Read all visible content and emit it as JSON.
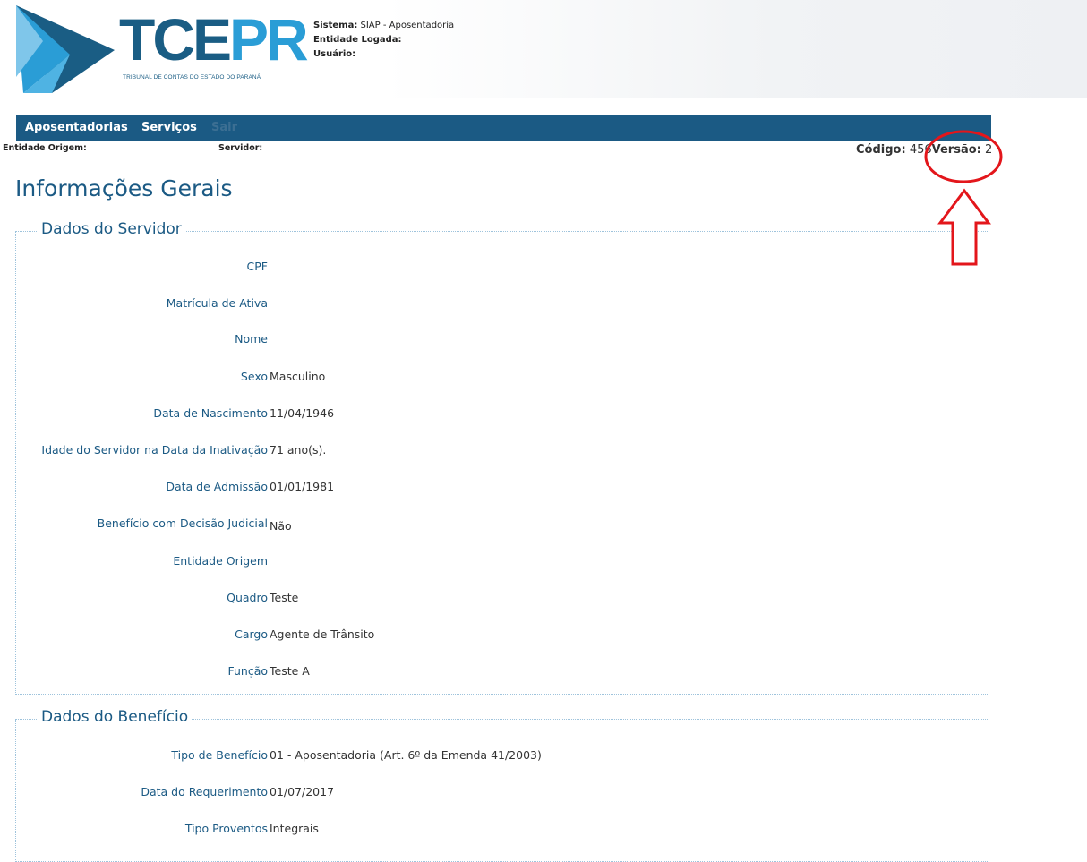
{
  "header": {
    "logo_tce": "TCE",
    "logo_pr": "PR",
    "logo_subtitle": "TRIBUNAL DE CONTAS DO ESTADO DO PARANÁ",
    "sistema_label": "Sistema:",
    "sistema_value": "SIAP - Aposentadoria",
    "entidade_label": "Entidade Logada:",
    "usuario_label": "Usuário:"
  },
  "menu": {
    "items": [
      "Aposentadorias",
      "Serviços",
      "Sair"
    ]
  },
  "subbar": {
    "entidade_origem_label": "Entidade Origem:",
    "servidor_label": "Servidor:",
    "codigo_label": "Código:",
    "codigo_value": "456",
    "versao_label": "Versão:",
    "versao_value": "2"
  },
  "page": {
    "title": "Informações Gerais"
  },
  "dados_servidor": {
    "legend": "Dados do Servidor",
    "rows": [
      {
        "label": "CPF",
        "value": ""
      },
      {
        "label": "Matrícula de Ativa",
        "value": ""
      },
      {
        "label": "Nome",
        "value": ""
      },
      {
        "label": "Sexo",
        "value": "Masculino"
      },
      {
        "label": "Data de Nascimento",
        "value": "11/04/1946"
      },
      {
        "label": "Idade do Servidor na Data da Inativação",
        "value": "71 ano(s)."
      },
      {
        "label": "Data de Admissão",
        "value": "01/01/1981"
      },
      {
        "label": "Benefício com Decisão Judicial",
        "value": "Não"
      },
      {
        "label": "Entidade Origem",
        "value": ""
      },
      {
        "label": "Quadro",
        "value": "Teste"
      },
      {
        "label": "Cargo",
        "value": "Agente de Trânsito"
      },
      {
        "label": "Função",
        "value": "Teste A"
      }
    ]
  },
  "dados_beneficio": {
    "legend": "Dados do Benefício",
    "rows": [
      {
        "label": "Tipo de Benefício",
        "value": "01 - Aposentadoria (Art. 6º da Emenda 41/2003)"
      },
      {
        "label": "Data do Requerimento",
        "value": "01/07/2017"
      },
      {
        "label": "Tipo Proventos",
        "value": "Integrais"
      }
    ]
  },
  "colors": {
    "brand_dark": "#1b5a84",
    "brand_light": "#2a9dd6",
    "annotation_red": "#e3161b"
  }
}
